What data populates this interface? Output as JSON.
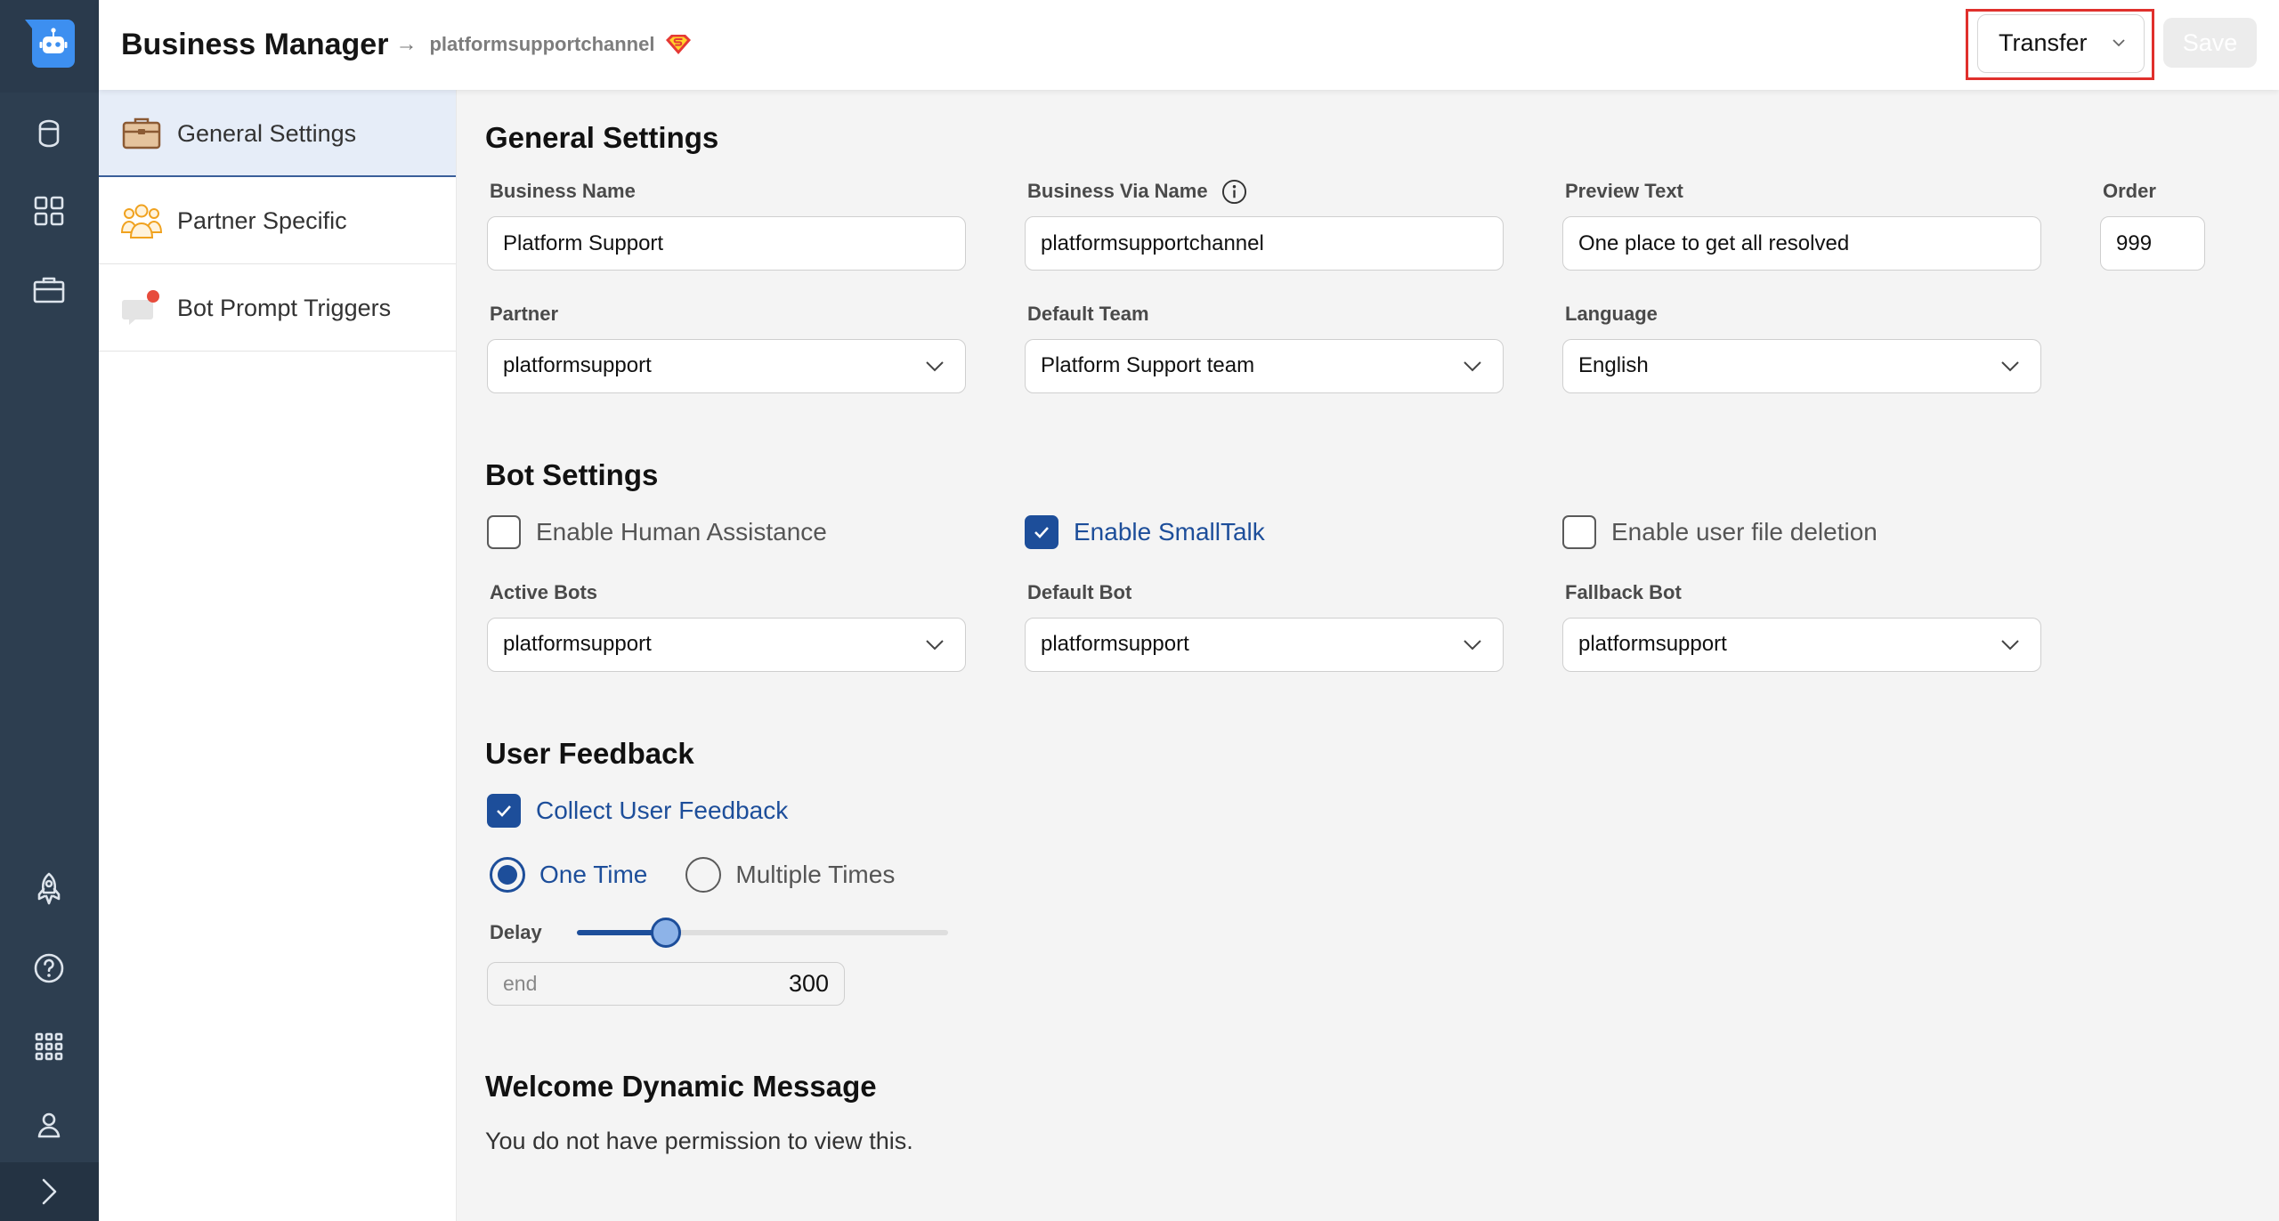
{
  "theme": {
    "accent": "#1d4e9a",
    "rail_bg": "#2d3e50",
    "highlight_outline": "#e0302c",
    "logo_blue": "#3d8ff0"
  },
  "rail": {
    "logo_icon": "bot-logo-icon",
    "items": [
      "database-icon",
      "apps-grid-icon",
      "briefcase-icon",
      "rocket-icon",
      "help-icon",
      "app-launcher-icon",
      "user-icon"
    ],
    "expand_icon": "chevron-right-icon"
  },
  "header": {
    "title": "Business Manager",
    "separator": "→",
    "channel": "platformsupportchannel",
    "channel_icon": "superman-shield-icon"
  },
  "toolbar": {
    "transfer_label": "Transfer",
    "transfer_icon": "chevron-down-icon",
    "save_label": "Save",
    "save_disabled": true
  },
  "nav": {
    "items": [
      {
        "label": "General Settings",
        "icon": "briefcase-icon",
        "selected": true
      },
      {
        "label": "Partner Specific",
        "icon": "partner-people-icon",
        "selected": false
      },
      {
        "label": "Bot Prompt Triggers",
        "icon": "chat-alert-icon",
        "selected": false
      }
    ]
  },
  "general": {
    "heading": "General Settings",
    "business_name": {
      "label": "Business Name",
      "value": "Platform Support"
    },
    "business_via_name": {
      "label": "Business Via Name",
      "value": "platformsupportchannel",
      "info_icon": "info-icon"
    },
    "preview_text": {
      "label": "Preview Text",
      "value": "One place to get all resolved"
    },
    "order": {
      "label": "Order",
      "value": "999"
    },
    "partner": {
      "label": "Partner",
      "value": "platformsupport"
    },
    "default_team": {
      "label": "Default Team",
      "value": "Platform Support team"
    },
    "language": {
      "label": "Language",
      "value": "English"
    }
  },
  "bot": {
    "heading": "Bot Settings",
    "human_assistance": {
      "label": "Enable Human Assistance",
      "checked": false
    },
    "smalltalk": {
      "label": "Enable SmallTalk",
      "checked": true
    },
    "file_deletion": {
      "label": "Enable user file deletion",
      "checked": false
    },
    "active_bots": {
      "label": "Active Bots",
      "value": "platformsupport"
    },
    "default_bot": {
      "label": "Default Bot",
      "value": "platformsupport"
    },
    "fallback_bot": {
      "label": "Fallback Bot",
      "value": "platformsupport"
    }
  },
  "feedback": {
    "heading": "User Feedback",
    "collect": {
      "label": "Collect User Feedback",
      "checked": true
    },
    "frequency": {
      "options": [
        {
          "label": "One Time",
          "selected": true
        },
        {
          "label": "Multiple Times",
          "selected": false
        }
      ]
    },
    "delay": {
      "label": "Delay",
      "unit_label": "end",
      "value": "300",
      "slider_fraction": 0.24
    }
  },
  "welcome": {
    "heading": "Welcome Dynamic Message",
    "message": "You do not have permission to view this."
  }
}
